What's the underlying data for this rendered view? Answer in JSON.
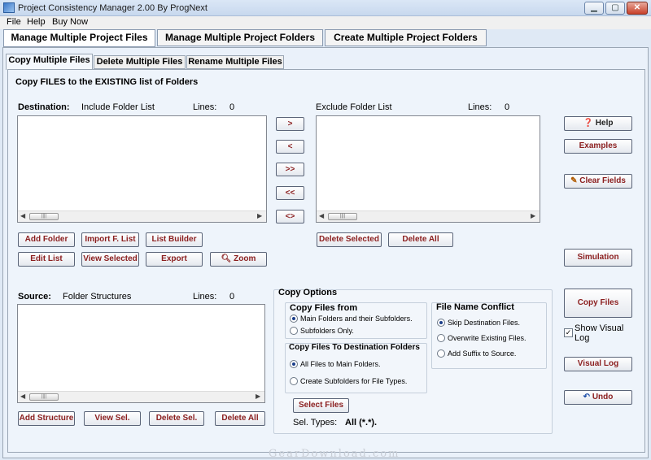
{
  "window": {
    "title": "Project Consistency Manager 2.00     By ProgNext",
    "min_label": "▁",
    "max_label": "▢",
    "close_label": "✕"
  },
  "menu": [
    "File",
    "Help",
    "Buy Now"
  ],
  "main_tabs": [
    "Manage Multiple Project Files",
    "Manage Multiple Project Folders",
    "Create Multiple Project Folders"
  ],
  "sub_tabs": [
    "Copy Multiple Files",
    "Delete Multiple Files",
    "Rename Multiple Files"
  ],
  "section_title": "Copy FILES to the EXISTING list of Folders",
  "destination": {
    "label": "Destination:",
    "include_label": "Include Folder List",
    "lines_label": "Lines:",
    "lines": "0",
    "buttons": [
      "Add Folder",
      "Import F. List",
      "List Builder",
      "Edit List",
      "View Selected",
      "Export",
      "Zoom"
    ]
  },
  "transfer_buttons": [
    ">",
    "<",
    ">>",
    "<<",
    "<>"
  ],
  "exclude": {
    "label": "Exclude Folder List",
    "lines_label": "Lines:",
    "lines": "0",
    "buttons": [
      "Delete Selected",
      "Delete All"
    ]
  },
  "source": {
    "label": "Source:",
    "structures_label": "Folder Structures",
    "lines_label": "Lines:",
    "lines": "0",
    "buttons": [
      "Add  Structure",
      "View Sel.",
      "Delete Sel.",
      "Delete All"
    ]
  },
  "copy_options": {
    "title": "Copy Options",
    "copy_from": {
      "title": "Copy Files from",
      "options": [
        "Main Folders and their Subfolders.",
        "Subfolders Only."
      ],
      "selected": 0
    },
    "copy_to": {
      "title": "Copy Files To Destination Folders",
      "options": [
        "All Files to Main  Folders.",
        "Create Subfolders for File Types."
      ],
      "selected": 0
    },
    "conflict": {
      "title": "File Name Conflict",
      "options": [
        "Skip Destination Files.",
        "Overwrite Existing Files.",
        "Add Suffix to Source."
      ],
      "selected": 0
    },
    "select_files": "Select Files",
    "sel_types_label": "Sel. Types:",
    "sel_types_value": "All (*.*)."
  },
  "right_buttons": {
    "help": "Help",
    "examples": "Examples",
    "clear_fields": "Clear Fields",
    "simulation": "Simulation",
    "copy_files": "Copy Files",
    "show_visual_log": "Show Visual Log",
    "visual_log": "Visual Log",
    "undo": "Undo"
  },
  "watermark": "GearDownload.com",
  "scroll_thumb": "||||"
}
